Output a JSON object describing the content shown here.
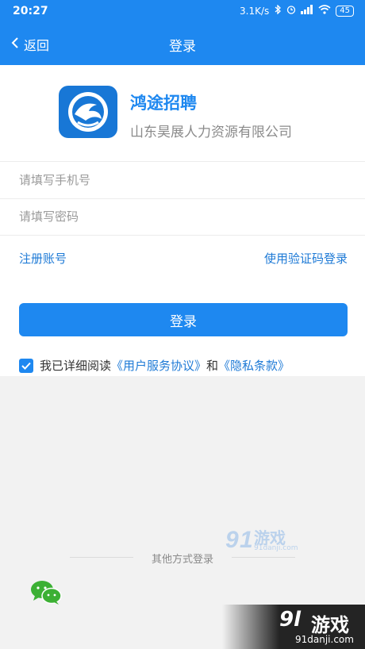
{
  "status_bar": {
    "time": "20:27",
    "network_speed": "3.1K/s",
    "battery": "45"
  },
  "navbar": {
    "back_label": "返回",
    "title": "登录"
  },
  "app": {
    "name": "鸿途招聘",
    "company": "山东昊展人力资源有限公司"
  },
  "form": {
    "phone_placeholder": "请填写手机号",
    "password_placeholder": "请填写密码",
    "register_link": "注册账号",
    "sms_login_link": "使用验证码登录",
    "login_button": "登录"
  },
  "agreement": {
    "checked": true,
    "prefix": "我已详细阅读",
    "user_agreement": "《用户服务协议》",
    "conjunction": "和",
    "privacy_policy": "《隐私条款》"
  },
  "other_login": {
    "label": "其他方式登录",
    "methods": [
      "wechat-icon"
    ]
  },
  "watermarks": {
    "center_brand": "游戏",
    "center_domain": "91danji.com",
    "corner_brand": "游戏",
    "corner_domain": "91danji.com"
  },
  "colors": {
    "primary": "#1e88f0",
    "link": "#1e7ad6",
    "wechat": "#3cb034"
  }
}
